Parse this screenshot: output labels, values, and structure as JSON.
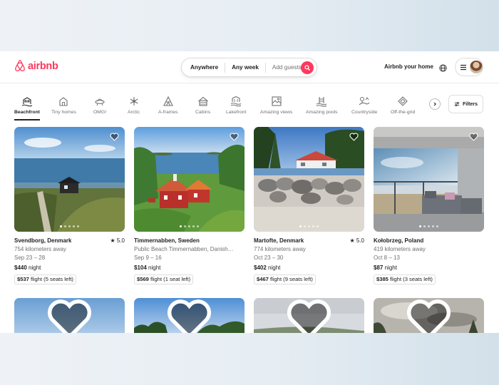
{
  "brand": {
    "name": "airbnb",
    "color": "#ff385c"
  },
  "search": {
    "where": "Anywhere",
    "when": "Any week",
    "guests": "Add guests",
    "icon": "search-icon"
  },
  "header": {
    "host_link": "Airbnb your home",
    "globe_icon": "globe-icon",
    "menu_icon": "hamburger-icon"
  },
  "categories": [
    {
      "label": "Beachfront",
      "icon": "beachfront-icon",
      "active": true
    },
    {
      "label": "Tiny homes",
      "icon": "tiny-home-icon"
    },
    {
      "label": "OMG!",
      "icon": "ufo-icon"
    },
    {
      "label": "Arctic",
      "icon": "snowflake-icon"
    },
    {
      "label": "A-frames",
      "icon": "a-frame-icon"
    },
    {
      "label": "Cabins",
      "icon": "cabin-icon"
    },
    {
      "label": "Lakefront",
      "icon": "lakefront-icon"
    },
    {
      "label": "Amazing views",
      "icon": "views-icon"
    },
    {
      "label": "Amazing pools",
      "icon": "pool-icon"
    },
    {
      "label": "Countryside",
      "icon": "countryside-icon"
    },
    {
      "label": "Off-the-grid",
      "icon": "off-grid-icon"
    }
  ],
  "filters_label": "Filters",
  "listings": [
    {
      "location": "Svendborg, Denmark",
      "rating": "5.0",
      "distance": "754 kilometers away",
      "dates": "Sep 23 – 28",
      "price": "$440",
      "price_unit": "night",
      "flight_price": "$537",
      "flight_text": "flight (5 seats left)"
    },
    {
      "location": "Timmernabben, Sweden",
      "rating": "",
      "distance": "Public Beach Timmernabben, Danish…",
      "dates": "Sep 9 – 16",
      "price": "$104",
      "price_unit": "night",
      "flight_price": "$569",
      "flight_text": "flight (1 seat left)"
    },
    {
      "location": "Martofte, Denmark",
      "rating": "5.0",
      "distance": "774 kilometers away",
      "dates": "Oct 23 – 30",
      "price": "$402",
      "price_unit": "night",
      "flight_price": "$467",
      "flight_text": "flight (9 seats left)"
    },
    {
      "location": "Kołobrzeg, Poland",
      "rating": "",
      "distance": "419 kilometers away",
      "dates": "Oct 8 – 13",
      "price": "$87",
      "price_unit": "night",
      "flight_price": "$385",
      "flight_text": "flight (3 seats left)"
    }
  ]
}
